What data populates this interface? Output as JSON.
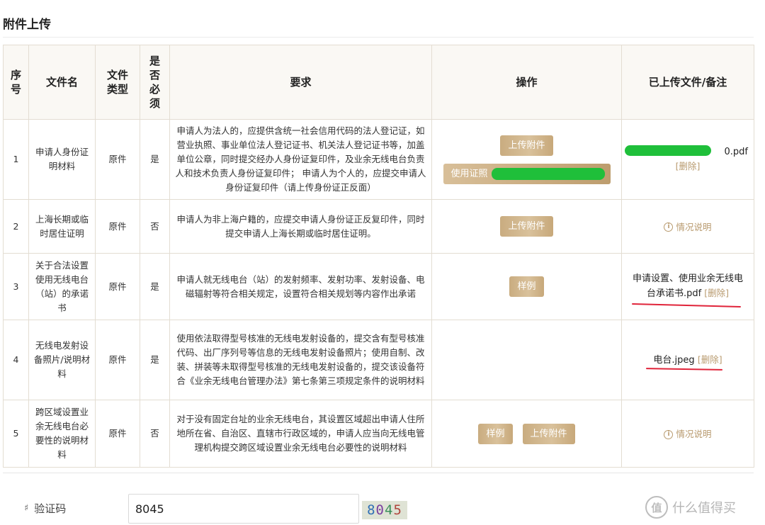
{
  "section": {
    "title": "附件上传"
  },
  "table": {
    "headers": {
      "index": "序号",
      "filename": "文件名",
      "filetype": "文件类型",
      "required": "是否必须",
      "requirement": "要求",
      "action": "操作",
      "uploaded": "已上传文件/备注"
    },
    "rows": [
      {
        "index": "1",
        "filename": "申请人身份证明材料",
        "filetype": "原件",
        "required": "是",
        "requirement": "申请人为法人的，应提供含统一社会信用代码的法人登记证，如营业执照、事业单位法人登记证书、机关法人登记证书等，加盖单位公章，同时提交经办人身份证复印件，及业余无线电台负责人和技术负责人身份证复印件； 申请人为个人的，应提交申请人身份证复印件（请上传身份证正反面）",
        "buttons": [
          "上传附件"
        ],
        "cert_button": "使用证照",
        "uploaded_file": "0.pdf",
        "delete_label": "[删除]"
      },
      {
        "index": "2",
        "filename": "上海长期或临时居住证明",
        "filetype": "原件",
        "required": "否",
        "requirement": "申请人为非上海户籍的，应提交申请人身份证正反复印件，同时提交申请人上海长期或临时居住证明。",
        "buttons": [
          "上传附件"
        ],
        "note": "情况说明"
      },
      {
        "index": "3",
        "filename": "关于合法设置使用无线电台（站）的承诺书",
        "filetype": "原件",
        "required": "是",
        "requirement": "申请人就无线电台（站）的发射频率、发射功率、发射设备、电磁辐射等符合相关规定，设置符合相关规划等内容作出承诺",
        "buttons": [
          "样例"
        ],
        "uploaded_file": "申请设置、使用业余无线电台承诺书.pdf",
        "delete_label": "[删除]"
      },
      {
        "index": "4",
        "filename": "无线电发射设备照片/说明材料",
        "filetype": "原件",
        "required": "是",
        "requirement": "使用依法取得型号核准的无线电发射设备的，提交含有型号核准代码、出厂序列号等信息的无线电发射设备照片；使用自制、改装、拼装等未取得型号核准的无线电发射设备的，提交该设备符合《业余无线电台管理办法》第七条第三项规定条件的说明材料",
        "uploaded_file": "电台.jpeg",
        "delete_label": "[删除]"
      },
      {
        "index": "5",
        "filename": "跨区域设置业余无线电台必要性的说明材料",
        "filetype": "原件",
        "required": "否",
        "requirement": "对于没有固定台址的业余无线电台，其设置区域超出申请人住所地所在省、自治区、直辖市行政区域的，申请人应当向无线电管理机构提交跨区域设置业余无线电台必要性的说明材料",
        "buttons": [
          "样例",
          "上传附件"
        ],
        "note": "情况说明"
      }
    ]
  },
  "captcha": {
    "label": "验证码",
    "value": "8045",
    "image_text": "8045"
  },
  "watermark": {
    "text": "什么值得买",
    "icon": "zhi-logo-icon"
  },
  "colors": {
    "accent_gold": "#c9ab7f",
    "redaction_green": "#1fbf3a",
    "annotation_red": "#e0243a"
  }
}
